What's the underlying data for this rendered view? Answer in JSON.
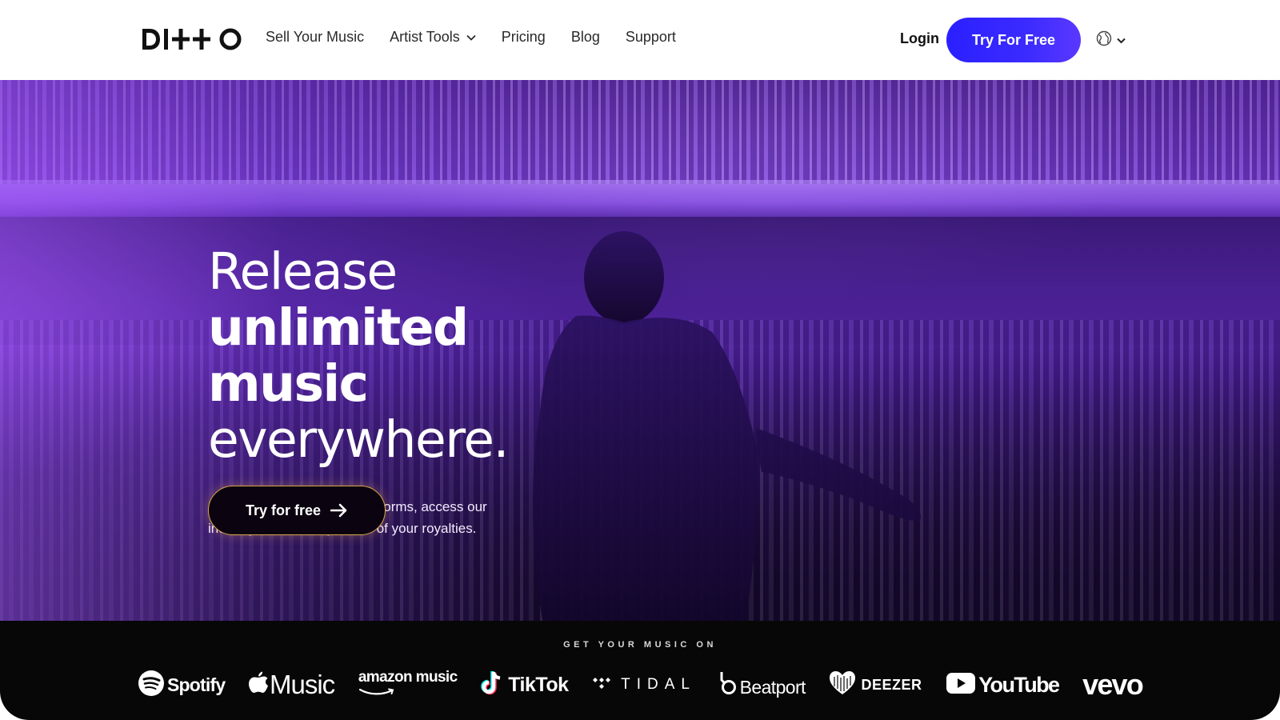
{
  "header": {
    "logo_text": "DITTO",
    "nav": [
      {
        "label": "Sell Your Music"
      },
      {
        "label": "Artist Tools",
        "has_dropdown": true
      },
      {
        "label": "Pricing"
      },
      {
        "label": "Blog"
      },
      {
        "label": "Support"
      }
    ],
    "login_label": "Login",
    "cta_label": "Try For Free",
    "language_icon": "globe-icon"
  },
  "hero": {
    "headline_lines": [
      "Release",
      "unlimited",
      "music",
      "everywhere."
    ],
    "subtitle": "Upload to all the biggest platforms, access our industry tools & keep 100% of your royalties.",
    "cta_label": "Try for free",
    "cta_icon": "arrow-right-icon"
  },
  "platforms": {
    "title": "GET YOUR MUSIC ON",
    "logos": [
      {
        "name": "Spotify",
        "icon": "spotify-icon"
      },
      {
        "name": "Music",
        "icon": "apple-icon"
      },
      {
        "name": "amazon music",
        "icon": "amazon-smile-icon"
      },
      {
        "name": "TikTok",
        "icon": "tiktok-icon"
      },
      {
        "name": "TIDAL",
        "icon": "tidal-icon"
      },
      {
        "name": "Beatport",
        "icon": "beatport-icon"
      },
      {
        "name": "DEEZER",
        "icon": "deezer-icon"
      },
      {
        "name": "YouTube",
        "icon": "youtube-icon"
      },
      {
        "name": "vevo"
      }
    ]
  },
  "colors": {
    "primary_cta": "#2a20ff",
    "hero_purple": "#7d3fd8",
    "hero_cta_border": "#d8a64a",
    "platform_bg": "#070707"
  }
}
